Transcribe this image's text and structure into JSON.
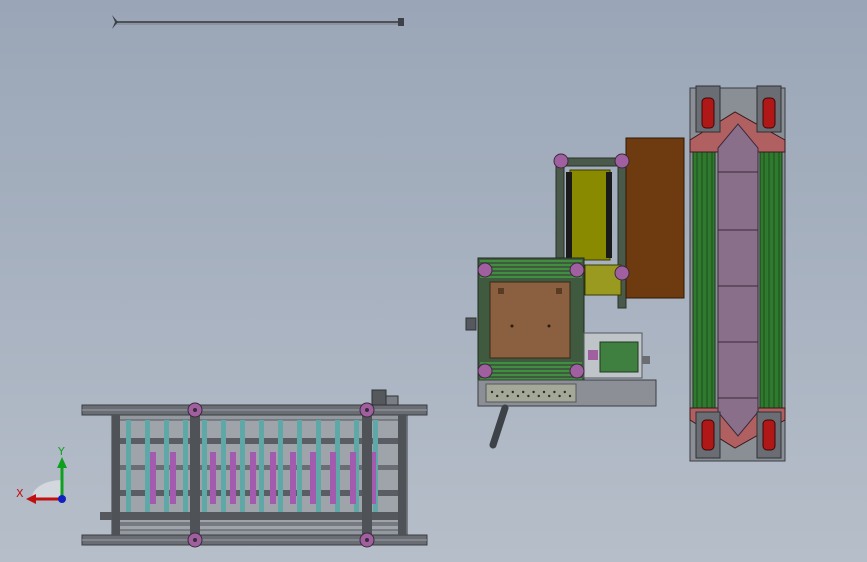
{
  "viewport": {
    "background_top": "#9aa6b7",
    "background_bottom": "#b6bec9",
    "triad": {
      "x_label": "X",
      "y_label": "Y",
      "x_color": "#c01010",
      "y_color": "#10a020",
      "z_color": "#1020c0"
    }
  },
  "colors": {
    "frame": "#5a5e64",
    "frame_light": "#8a8f96",
    "cyan": "#5fa8a8",
    "violet": "#a35bb0",
    "green": "#3f8f3f",
    "olive": "#8a8a00",
    "brown": "#6e3a0f",
    "tan": "#8a6040",
    "mauve": "#8a6f8a",
    "red": "#b01818",
    "joint": "#a060a0"
  },
  "models": [
    {
      "name": "lower-rack-assembly",
      "view": "side"
    },
    {
      "name": "center-workstation-assembly",
      "view": "top"
    },
    {
      "name": "right-conveyor-assembly",
      "view": "top"
    },
    {
      "name": "top-rod-part",
      "view": "top"
    }
  ]
}
